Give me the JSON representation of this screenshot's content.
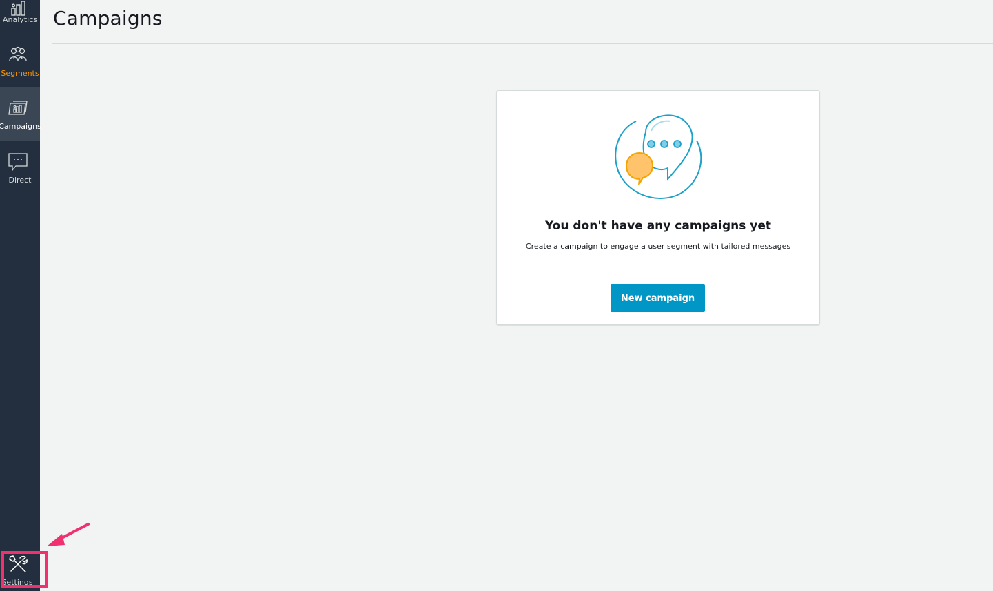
{
  "sidebar": {
    "items": [
      {
        "id": "analytics",
        "label": "Analytics",
        "icon": "bar-chart-icon"
      },
      {
        "id": "segments",
        "label": "Segments",
        "icon": "users-icon",
        "color": "#ff9900"
      },
      {
        "id": "campaigns",
        "label": "Campaigns",
        "icon": "campaign-icon",
        "active": true
      },
      {
        "id": "direct",
        "label": "Direct",
        "icon": "message-icon"
      },
      {
        "id": "settings",
        "label": "Settings",
        "icon": "tools-icon"
      }
    ]
  },
  "header": {
    "title": "Campaigns"
  },
  "empty_state": {
    "title": "You don't have any campaigns yet",
    "description": "Create a campaign to engage a user segment with tailored messages",
    "button_label": "New campaign",
    "illustration": "chat-bubbles-icon"
  },
  "colors": {
    "sidebar_bg": "#232f3e",
    "accent_orange": "#ff9900",
    "primary_button": "#0096c5",
    "annotation": "#f0306f"
  }
}
